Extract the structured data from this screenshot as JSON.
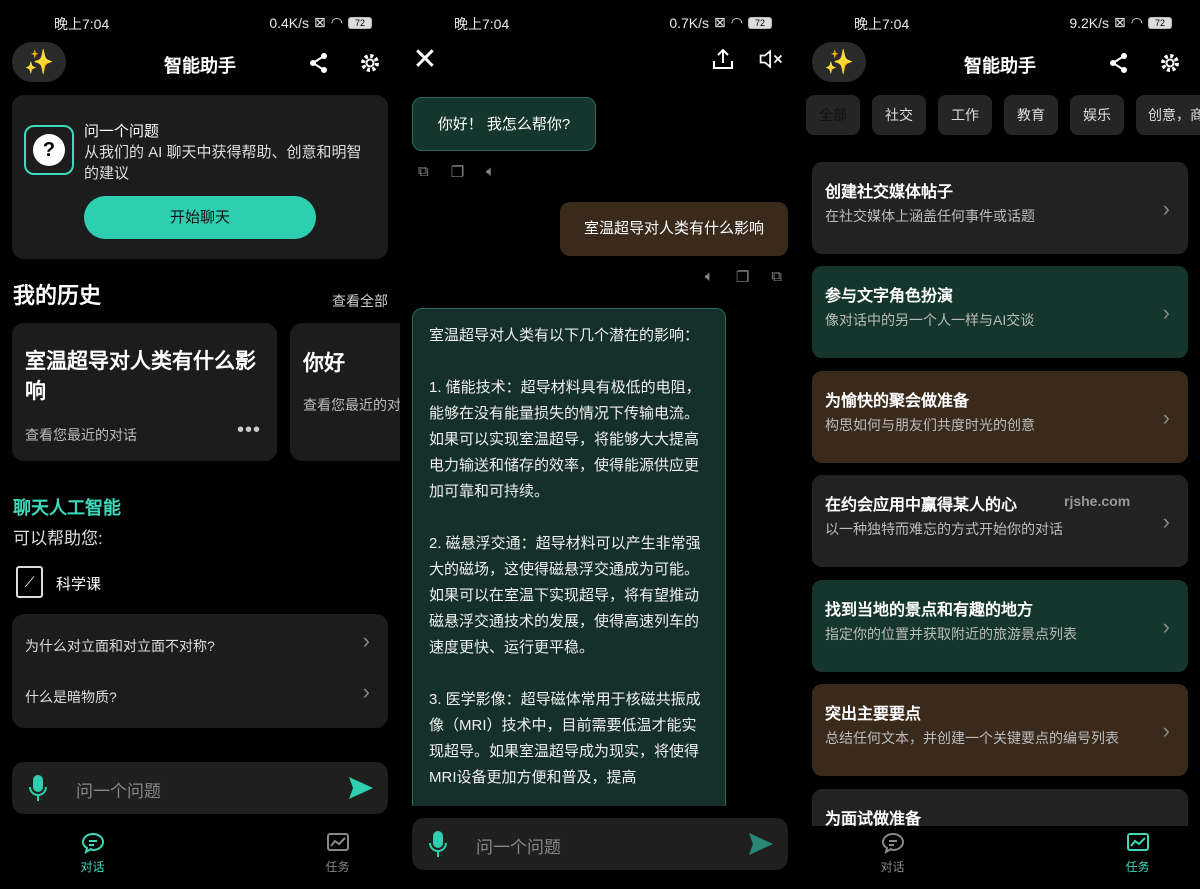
{
  "screen1": {
    "status": {
      "time": "晚上7:04",
      "speed": "0.4K/s",
      "battery": "72"
    },
    "header": {
      "title": "智能助手"
    },
    "ask_card": {
      "title": "问一个问题",
      "desc": "从我们的 AI 聊天中获得帮助、创意和明智的建议",
      "button": "开始聊天"
    },
    "history": {
      "title": "我的历史",
      "view_all": "查看全部",
      "items": [
        {
          "title": "室温超导对人类有什么影响",
          "sub": "查看您最近的对话"
        },
        {
          "title": "你好",
          "sub": "查看您最近的对话"
        }
      ]
    },
    "chat_ai": {
      "title": "聊天人工智能",
      "sub": "可以帮助您:",
      "topic": "科学课",
      "questions": [
        "为什么对立面和对立面不对称?",
        "什么是暗物质?"
      ]
    },
    "input_placeholder": "问一个问题",
    "nav": {
      "chat": "对话",
      "tasks": "任务"
    }
  },
  "screen2": {
    "status": {
      "time": "晚上7:04",
      "speed": "0.7K/s",
      "battery": "72"
    },
    "greeting": "你好！ 我怎么帮你?",
    "user_msg": "室温超导对人类有什么影响",
    "answer": [
      "室温超导对人类有以下几个潜在的影响：",
      "1. 储能技术：超导材料具有极低的电阻，能够在没有能量损失的情况下传输电流。如果可以实现室温超导，将能够大大提高电力输送和储存的效率，使得能源供应更加可靠和可持续。",
      "2. 磁悬浮交通：超导材料可以产生非常强大的磁场，这使得磁悬浮交通成为可能。如果可以在室温下实现超导，将有望推动磁悬浮交通技术的发展，使得高速列车的速度更快、运行更平稳。",
      "3. 医学影像：超导磁体常用于核磁共振成像（MRI）技术中，目前需要低温才能实现超导。如果室温超导成为现实，将使得MRI设备更加方便和普及，提高"
    ],
    "input_placeholder": "问一个问题"
  },
  "screen3": {
    "status": {
      "time": "晚上7:04",
      "speed": "9.2K/s",
      "battery": "72"
    },
    "header": {
      "title": "智能助手"
    },
    "chips": [
      "全部",
      "社交",
      "工作",
      "教育",
      "娱乐",
      "创意，商"
    ],
    "tasks": [
      {
        "title": "创建社交媒体帖子",
        "desc": "在社交媒体上涵盖任何事件或话题",
        "color": "#222222"
      },
      {
        "title": "参与文字角色扮演",
        "desc": "像对话中的另一个人一样与AI交谈",
        "color": "#15362c"
      },
      {
        "title": "为愉快的聚会做准备",
        "desc": "构思如何与朋友们共度时光的创意",
        "color": "#3a2a1c"
      },
      {
        "title": "在约会应用中赢得某人的心",
        "desc": "以一种独特而难忘的方式开始你的对话",
        "color": "#222222"
      },
      {
        "title": "找到当地的景点和有趣的地方",
        "desc": "指定你的位置并获取附近的旅游景点列表",
        "color": "#15362c"
      },
      {
        "title": "突出主要要点",
        "desc": "总结任何文本，并创建一个关键要点的编号列表",
        "color": "#3a2a1c"
      },
      {
        "title": "为面试做准备",
        "desc": "",
        "color": "#222222"
      }
    ],
    "watermark": "rjshe.com",
    "nav": {
      "chat": "对话",
      "tasks": "任务"
    }
  },
  "colors": {
    "accent": "#2ecfb0",
    "bg": "#000000",
    "card": "#1c1c1c"
  }
}
